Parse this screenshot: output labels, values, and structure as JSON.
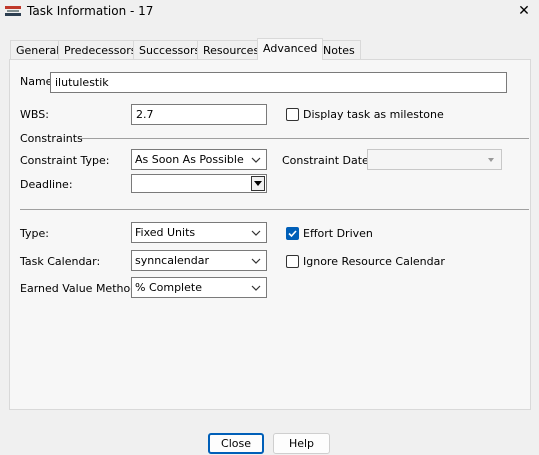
{
  "window": {
    "title": "Task Information - 17",
    "icon": "app-logo-icon",
    "close_glyph": "✕"
  },
  "tabs": [
    {
      "label": "General",
      "active": false
    },
    {
      "label": "Predecessors",
      "active": false
    },
    {
      "label": "Successors",
      "active": false
    },
    {
      "label": "Resources",
      "active": false
    },
    {
      "label": "Advanced",
      "active": true
    },
    {
      "label": "Notes",
      "active": false
    }
  ],
  "form": {
    "name_label": "Name:",
    "name_value": "ilutulestik",
    "wbs_label": "WBS:",
    "wbs_value": "2.7",
    "milestone_label": "Display task as milestone",
    "milestone_checked": false,
    "constraints_heading": "Constraints",
    "constraint_type_label": "Constraint Type:",
    "constraint_type_value": "As Soon As Possible",
    "constraint_date_label": "Constraint Date:",
    "constraint_date_value": "",
    "deadline_label": "Deadline:",
    "deadline_value": "",
    "type_label": "Type:",
    "type_value": "Fixed Units",
    "effort_driven_label": "Effort Driven",
    "effort_driven_checked": true,
    "task_calendar_label": "Task Calendar:",
    "task_calendar_value": "synncalendar",
    "ignore_calendar_label": "Ignore Resource Calendar",
    "ignore_calendar_checked": false,
    "earned_value_label": "Earned Value Method:",
    "earned_value_value": "% Complete"
  },
  "buttons": {
    "close_label": "Close",
    "help_label": "Help"
  },
  "colors": {
    "accent": "#005fb8",
    "panel": "#f7f7f7",
    "window": "#f0f0f0"
  }
}
